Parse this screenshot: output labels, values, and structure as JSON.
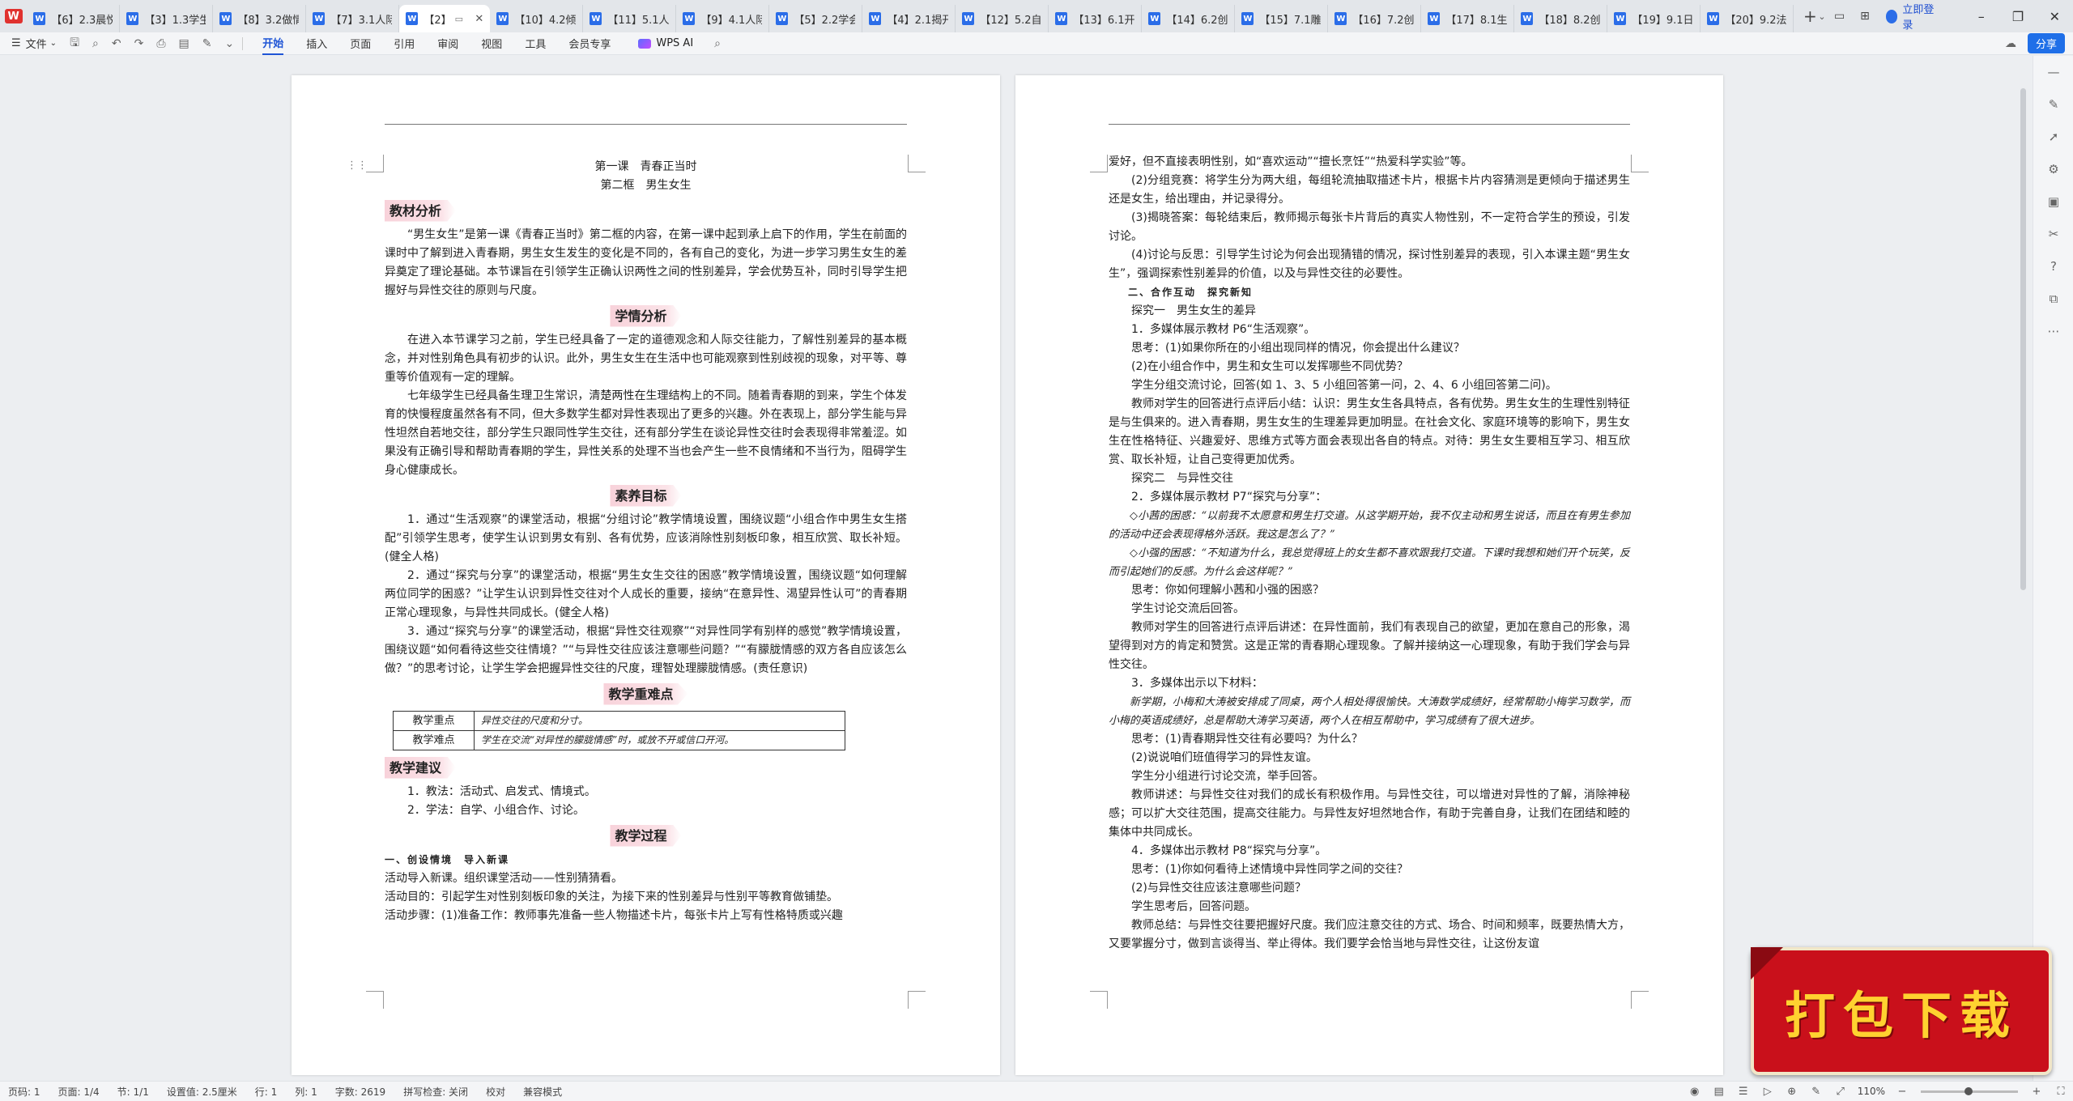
{
  "tabbar": {
    "tabs": [
      {
        "label": "【6】2.3晨悦"
      },
      {
        "label": "【3】1.3学生"
      },
      {
        "label": "【8】3.2做情"
      },
      {
        "label": "【7】3.1人际"
      },
      {
        "label": "【2】",
        "active": true
      },
      {
        "label": "【10】4.2倾听"
      },
      {
        "label": "【11】5.1人生"
      },
      {
        "label": "【9】4.1人际"
      },
      {
        "label": "【5】2.2学会"
      },
      {
        "label": "【4】2.1揭开"
      },
      {
        "label": "【12】5.2自我"
      },
      {
        "label": "【13】6.1开"
      },
      {
        "label": "【14】6.2创"
      },
      {
        "label": "【15】7.1雕"
      },
      {
        "label": "【16】7.2创"
      },
      {
        "label": "【17】8.1生"
      },
      {
        "label": "【18】8.2创"
      },
      {
        "label": "【19】9.1日"
      },
      {
        "label": "【20】9.2法"
      }
    ],
    "login_label": "立即登录"
  },
  "ribbon": {
    "file_label": "文件",
    "tabs": [
      "开始",
      "插入",
      "页面",
      "引用",
      "审阅",
      "视图",
      "工具",
      "会员专享"
    ],
    "ai_label": "WPS AI",
    "share_label": "分享"
  },
  "page1": {
    "title1": "第一课　青春正当时",
    "title2": "第二框　男生女生",
    "sec1": "教材分析",
    "p1": "“男生女生”是第一课《青春正当时》第二框的内容，在第一课中起到承上启下的作用，学生在前面的课时中了解到进入青春期，男生女生发生的变化是不同的，各有自己的变化，为进一步学习男生女生的差异奠定了理论基础。本节课旨在引领学生正确认识两性之间的性别差异，学会优势互补，同时引导学生把握好与异性交往的原则与尺度。",
    "sec2": "学情分析",
    "p2": "在进入本节课学习之前，学生已经具备了一定的道德观念和人际交往能力，了解性别差异的基本概念，并对性别角色具有初步的认识。此外，男生女生在生活中也可能观察到性别歧视的现象，对平等、尊重等价值观有一定的理解。",
    "p3": "七年级学生已经具备生理卫生常识，清楚两性在生理结构上的不同。随着青春期的到来，学生个体发育的快慢程度虽然各有不同，但大多数学生都对异性表现出了更多的兴趣。外在表现上，部分学生能与异性坦然自若地交往，部分学生只跟同性学生交往，还有部分学生在谈论异性交往时会表现得非常羞涩。如果没有正确引导和帮助青春期的学生，异性关系的处理不当也会产生一些不良情绪和不当行为，阻碍学生身心健康成长。",
    "sec3": "素养目标",
    "g1": "1．通过“生活观察”的课堂活动，根据“分组讨论”教学情境设置，围绕议题“小组合作中男生女生搭配”引领学生思考，使学生认识到男女有别、各有优势，应该消除性别刻板印象，相互欣赏、取长补短。(健全人格)",
    "g2": "2．通过“探究与分享”的课堂活动，根据“男生女生交往的困惑”教学情境设置，围绕议题“如何理解两位同学的困惑？”让学生认识到异性交往对个人成长的重要，接纳“在意异性、渴望异性认可”的青春期正常心理现象，与异性共同成长。(健全人格)",
    "g3": "3．通过“探究与分享”的课堂活动，根据“异性交往观察”“对异性同学有别样的感觉”教学情境设置，围绕议题“如何看待这些交往情境？”“与异性交往应该注意哪些问题？”“有朦胧情感的双方各自应该怎么做？”的思考讨论，让学生学会把握异性交往的尺度，理智处理朦胧情感。(责任意识)",
    "sec4": "教学重难点",
    "table": [
      {
        "label": "教学重点",
        "value": "异性交往的尺度和分寸。"
      },
      {
        "label": "教学难点",
        "value": "学生在交流“对异性的朦胧情感”时，或放不开或信口开河。"
      }
    ],
    "sec5": "教学建议",
    "s1": "1．教法：活动式、启发式、情境式。",
    "s2": "2．学法：自学、小组合作、讨论。",
    "sec6": "教学过程",
    "sub1": "一、创设情境　导入新课",
    "q1": "活动导入新课。组织课堂活动——性别猜猜看。",
    "q2": "活动目的：引起学生对性别刻板印象的关注，为接下来的性别差异与性别平等教育做铺垫。",
    "q3": "活动步骤：(1)准备工作：教师事先准备一些人物描述卡片，每张卡片上写有性格特质或兴趣"
  },
  "page2": {
    "l1": "爱好，但不直接表明性别，如“喜欢运动”“擅长烹饪”“热爱科学实验”等。",
    "l2": "(2)分组竞赛：将学生分为两大组，每组轮流抽取描述卡片，根据卡片内容猜测是更倾向于描述男生还是女生，给出理由，并记录得分。",
    "l3": "(3)揭晓答案：每轮结束后，教师揭示每张卡片背后的真实人物性别，不一定符合学生的预设，引发讨论。",
    "l4": "(4)讨论与反思：引导学生讨论为何会出现猜错的情况，探讨性别差异的表现，引入本课主题“男生女生”，强调探索性别差异的价值，以及与异性交往的必要性。",
    "sub2": "二、合作互动　探究新知",
    "e1": "探究一　男生女生的差异",
    "e2": "1．多媒体展示教材 P6“生活观察”。",
    "e3": "思考：(1)如果你所在的小组出现同样的情况，你会提出什么建议？",
    "e4": "(2)在小组合作中，男生和女生可以发挥哪些不同优势？",
    "e5": "学生分组交流讨论，回答(如 1、3、5 小组回答第一问，2、4、6 小组回答第二问)。",
    "e6": "教师对学生的回答进行点评后小结：认识：男生女生各具特点，各有优势。男生女生的生理性别特征是与生俱来的。进入青春期，男生女生的生理差异更加明显。在社会文化、家庭环境等的影响下，男生女生在性格特征、兴趣爱好、思维方式等方面会表现出各自的特点。对待：男生女生要相互学习、相互欣赏、取长补短，让自己变得更加优秀。",
    "e7": "探究二　与异性交往",
    "e8": "2．多媒体展示教材 P7“探究与分享”：",
    "e9": "◇小茜的困惑：“以前我不太愿意和男生打交道。从这学期开始，我不仅主动和男生说话，而且在有男生参加的活动中还会表现得格外活跃。我这是怎么了？”",
    "e10": "◇小强的困惑：“不知道为什么，我总觉得班上的女生都不喜欢跟我打交道。下课时我想和她们开个玩笑，反而引起她们的反感。为什么会这样呢？”",
    "e11": "思考：你如何理解小茜和小强的困惑？",
    "e12": "学生讨论交流后回答。",
    "e13": "教师对学生的回答进行点评后讲述：在异性面前，我们有表现自己的欲望，更加在意自己的形象，渴望得到对方的肯定和赞赏。这是正常的青春期心理现象。了解并接纳这一心理现象，有助于我们学会与异性交往。",
    "e14": "3．多媒体出示以下材料：",
    "e15": "新学期，小梅和大涛被安排成了同桌，两个人相处得很愉快。大涛数学成绩好，经常帮助小梅学习数学，而小梅的英语成绩好，总是帮助大涛学习英语，两个人在相互帮助中，学习成绩有了很大进步。",
    "e16": "思考：(1)青春期异性交往有必要吗？为什么？",
    "e17": "(2)说说咱们班值得学习的异性友谊。",
    "e18": "学生分小组进行讨论交流，举手回答。",
    "e19": "教师讲述：与异性交往对我们的成长有积极作用。与异性交往，可以增进对异性的了解，消除神秘感；可以扩大交往范围，提高交往能力。与异性友好坦然地合作，有助于完善自身，让我们在团结和睦的集体中共同成长。",
    "e20": "4．多媒体出示教材 P8“探究与分享”。",
    "e21": "思考：(1)你如何看待上述情境中异性同学之间的交往？",
    "e22": "(2)与异性交往应该注意哪些问题？",
    "e23": "学生思考后，回答问题。",
    "e24": "教师总结：与异性交往要把握好尺度。我们应注意交往的方式、场合、时间和频率，既要热情大方，又要掌握分寸，做到言谈得当、举止得体。我们要学会恰当地与异性交往，让这份友谊"
  },
  "status": {
    "items": [
      "页码: 1",
      "页面: 1/4",
      "节: 1/1",
      "设置值: 2.5厘米",
      "行: 1",
      "列: 1",
      "字数: 2619",
      "拼写检查: 关闭",
      "校对",
      "兼容模式"
    ],
    "zoom": "110%"
  },
  "banner": {
    "text": "打包下载"
  },
  "colors": {
    "accent": "#1f55d6",
    "banner_bg": "#c9101b",
    "banner_text": "#ffd230",
    "section_tag": "#f8d2da"
  }
}
